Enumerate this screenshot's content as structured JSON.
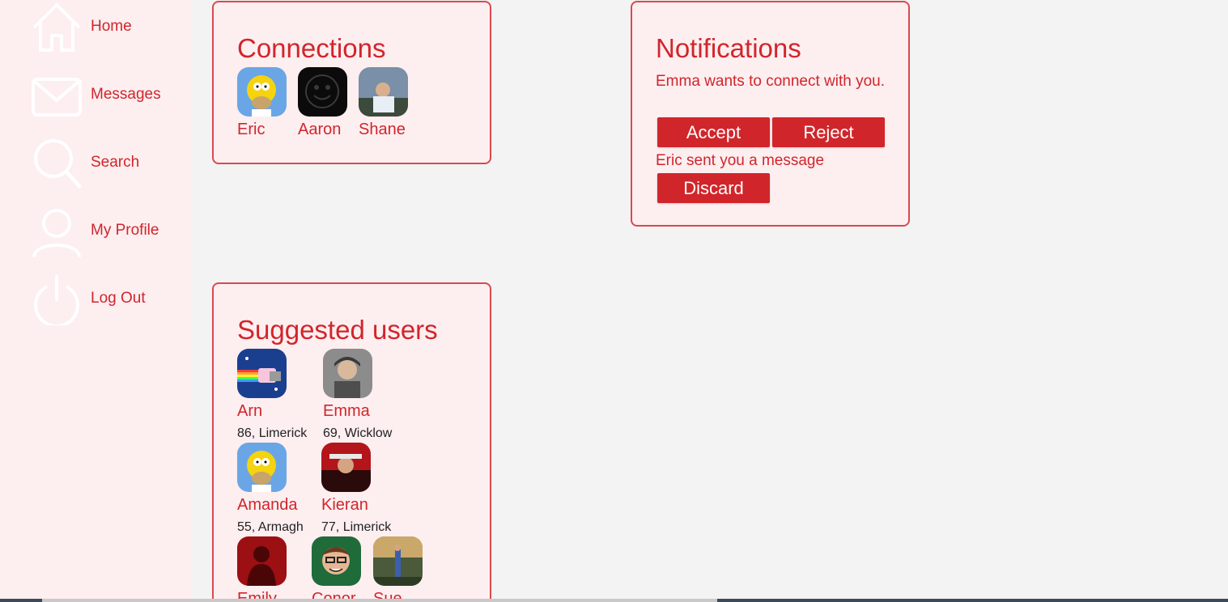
{
  "sidebar": {
    "items": [
      {
        "label": "Home",
        "icon": "home-icon"
      },
      {
        "label": "Messages",
        "icon": "envelope-icon"
      },
      {
        "label": "Search",
        "icon": "search-icon"
      },
      {
        "label": "My Profile",
        "icon": "user-icon"
      },
      {
        "label": "Log Out",
        "icon": "power-icon"
      }
    ]
  },
  "connections": {
    "title": "Connections",
    "users": [
      {
        "name": "Eric",
        "avatar": "homer-avatar"
      },
      {
        "name": "Aaron",
        "avatar": "dark-smiley-avatar"
      },
      {
        "name": "Shane",
        "avatar": "photo-avatar"
      }
    ]
  },
  "notifications": {
    "title": "Notifications",
    "items": [
      {
        "text": "Emma wants to connect with you.",
        "accept_label": "Accept",
        "reject_label": "Reject"
      },
      {
        "text": "Eric sent you a message",
        "discard_label": "Discard"
      }
    ]
  },
  "suggested": {
    "title": "Suggested users",
    "users": [
      {
        "name": "Arn",
        "meta": "86, Limerick",
        "avatar": "nyan-cat-avatar"
      },
      {
        "name": "Emma",
        "meta": "69, Wicklow",
        "avatar": "photo-avatar"
      },
      {
        "name": "Amanda",
        "meta": "55, Armagh",
        "avatar": "homer-avatar"
      },
      {
        "name": "Kieran",
        "meta": "77, Limerick",
        "avatar": "photo-avatar"
      },
      {
        "name": "Emily",
        "meta": "",
        "avatar": "silhouette-avatar"
      },
      {
        "name": "Conor",
        "meta": "",
        "avatar": "cartoon-avatar"
      },
      {
        "name": "Sue",
        "meta": "",
        "avatar": "photo-avatar"
      }
    ]
  },
  "colors": {
    "accent": "#d0262b",
    "card_bg": "#fdeef0",
    "page_bg": "#f3f3f3",
    "border": "#d84a4f"
  }
}
